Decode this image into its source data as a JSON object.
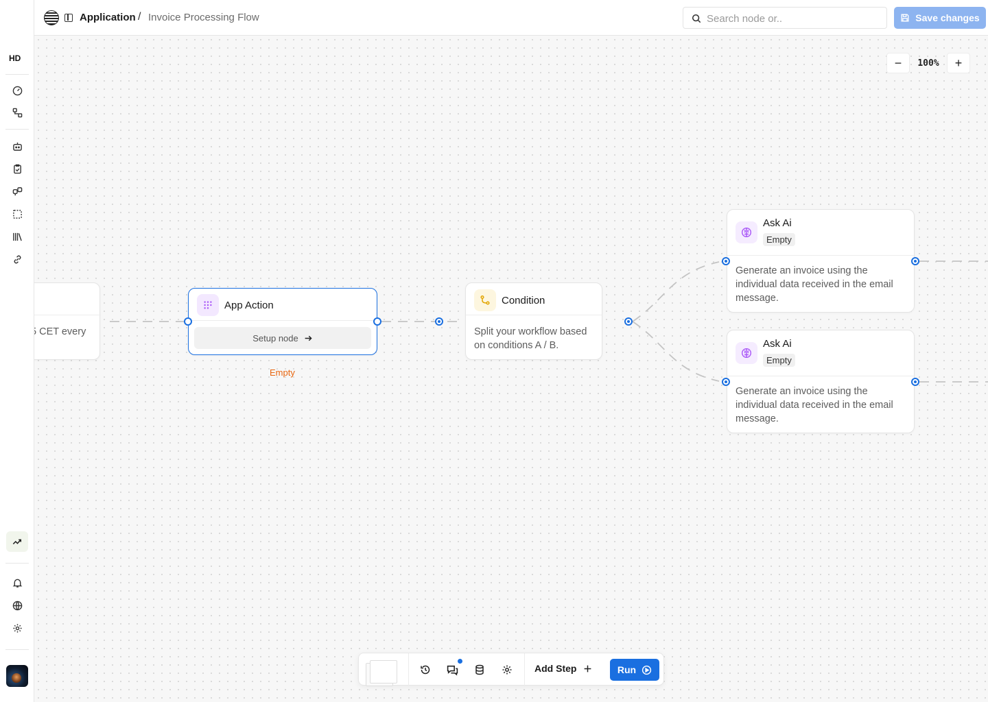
{
  "breadcrumb": {
    "app": "Application",
    "separator": "/",
    "flow": "Invoice Processing Flow"
  },
  "search": {
    "placeholder": "Search node or.."
  },
  "header": {
    "save_label": "Save changes"
  },
  "sidebar": {
    "items": [
      {
        "icon": "hd-logo-icon"
      },
      {
        "icon": "gauge-icon"
      },
      {
        "icon": "workflow-icon"
      },
      {
        "icon": "bot-icon"
      },
      {
        "icon": "clipboard-check-icon"
      },
      {
        "icon": "integrations-icon"
      },
      {
        "icon": "selection-icon"
      },
      {
        "icon": "library-icon"
      },
      {
        "icon": "link-icon"
      },
      {
        "icon": "trending-icon"
      },
      {
        "icon": "bell-icon"
      },
      {
        "icon": "globe-icon"
      },
      {
        "icon": "gear-icon"
      }
    ]
  },
  "zoom": {
    "value": "100%",
    "minus": "−",
    "plus": "+"
  },
  "nodes": {
    "trigger": {
      "desc": "5 CET every"
    },
    "app_action": {
      "title": "App Action",
      "setup_label": "Setup node",
      "status": "Empty"
    },
    "condition": {
      "title": "Condition",
      "desc": "Split your workflow based on conditions A / B."
    },
    "ask_ai_1": {
      "title": "Ask Ai",
      "badge": "Empty",
      "desc": "Generate an invoice using the individual data received in the email message."
    },
    "ask_ai_2": {
      "title": "Ask Ai",
      "badge": "Empty",
      "desc": "Generate an invoice using the individual data received in the email message."
    }
  },
  "toolbar": {
    "add_step_label": "Add Step",
    "run_label": "Run"
  },
  "colors": {
    "accent": "#1a6fe0",
    "save_disabled": "#8db4f0",
    "empty_status": "#e8650f",
    "condition_icon": "#e2a500",
    "ai_icon": "#a855f7"
  }
}
